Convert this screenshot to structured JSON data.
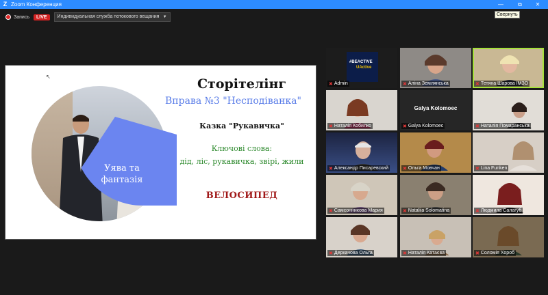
{
  "window": {
    "title": "Zoom Конференция",
    "app_icon": "Z"
  },
  "titlebar_buttons": {
    "minimize": "—",
    "restore": "⧉",
    "close": "✕"
  },
  "tooltip": "Свернуть",
  "toolbar": {
    "record_label": "Запись",
    "live_badge": "LIVE",
    "stream_service": "Индивидуальная служба потокового вещания"
  },
  "slide": {
    "title": "Сторітелінг",
    "subtitle": "Вправа №3 \"Несподіванка\"",
    "tale": "Казка \"Рукавичка\"",
    "keywords_heading": "Ключові слова:",
    "keywords": "дід, ліс, рукавичка, звірі, жили",
    "answer": "ВЕЛОСИПЕД",
    "wedge_text_line1": "Уява та",
    "wedge_text_line2": "фантазія"
  },
  "participants": [
    {
      "name": "Admin",
      "muted": true,
      "logo_top": "#BEACTIVE",
      "logo_bottom": "UActive"
    },
    {
      "name": "Аліна Землянська",
      "muted": true
    },
    {
      "name": "Тетяна Шарова ІМЗО",
      "muted": true,
      "active": true
    },
    {
      "name": "Наталія Кобилко",
      "muted": true
    },
    {
      "name": "Galya Kolomoec",
      "muted": true,
      "video_off": true
    },
    {
      "name": "Наталія Помаранська",
      "muted": true
    },
    {
      "name": "Александр Писаревский",
      "muted": true
    },
    {
      "name": "Ольга Мовчан",
      "muted": true
    },
    {
      "name": "Lina Funken",
      "muted": true
    },
    {
      "name": "Самсонникова Мария",
      "muted": true
    },
    {
      "name": "Nataliia Solomatina",
      "muted": true
    },
    {
      "name": "Людмила Салагуб",
      "muted": true
    },
    {
      "name": "Деркачова Ольга",
      "muted": true
    },
    {
      "name": "Наталія Катаєва",
      "muted": true
    },
    {
      "name": "Соломія Хороб",
      "muted": true
    }
  ]
}
